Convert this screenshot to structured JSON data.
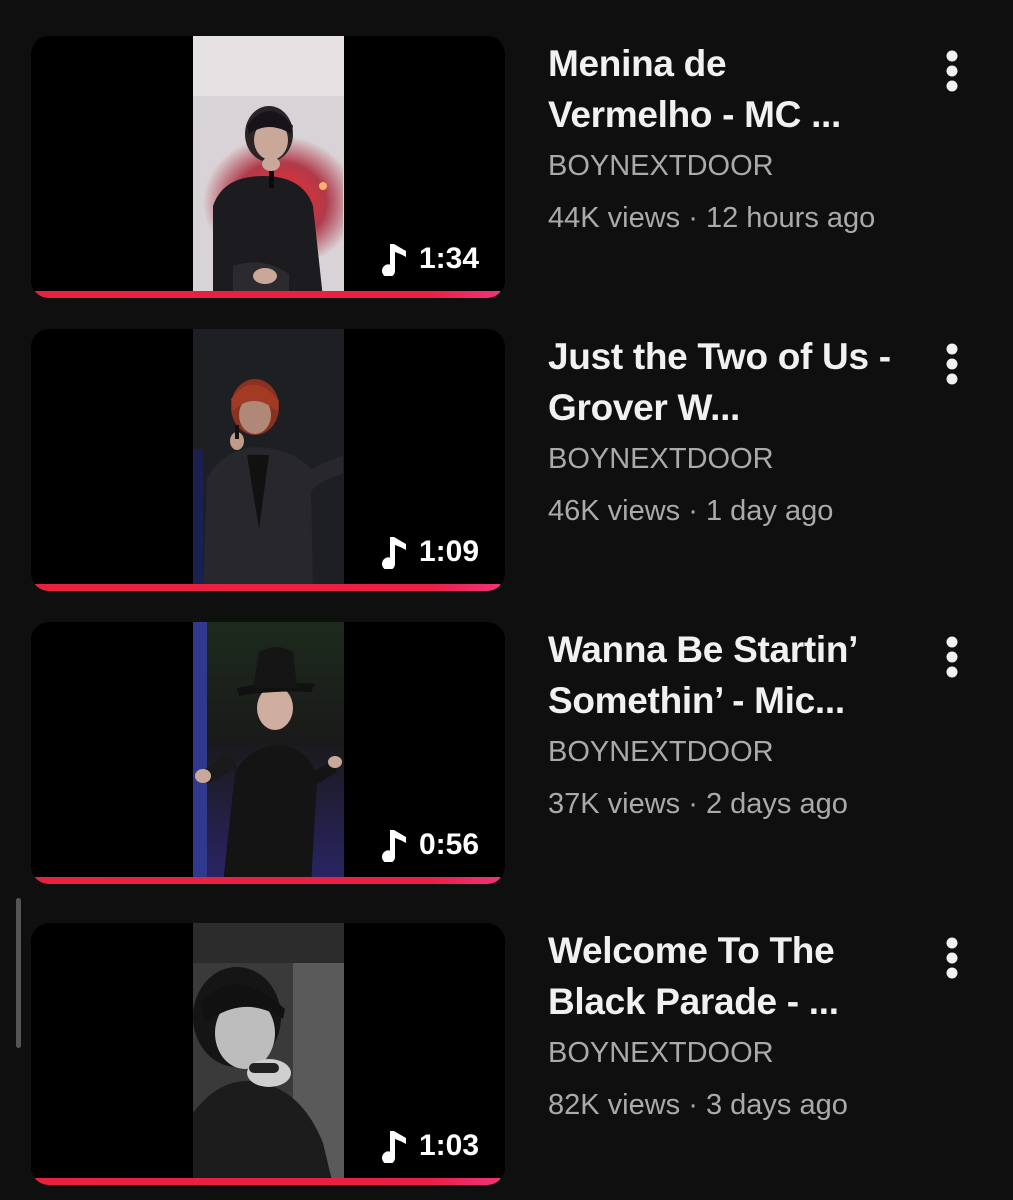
{
  "videos": [
    {
      "title": "Menina de Vermelho - MC ...",
      "channel": "BOYNEXTDOOR",
      "views": "44K views",
      "separator": "·",
      "age": "12 hours ago",
      "duration": "1:34",
      "watched_fraction": 0.99,
      "thumbnail_scene": "singer-red-hood"
    },
    {
      "title": "Just the Two of Us - Grover W...",
      "channel": "BOYNEXTDOOR",
      "views": "46K views",
      "separator": "·",
      "age": "1 day ago",
      "duration": "1:09",
      "watched_fraction": 0.99,
      "thumbnail_scene": "singer-dark-suit"
    },
    {
      "title": "Wanna Be Startin’ Somethin’ - Mic...",
      "channel": "BOYNEXTDOOR",
      "views": "37K views",
      "separator": "·",
      "age": "2 days ago",
      "duration": "0:56",
      "watched_fraction": 0.99,
      "thumbnail_scene": "dancer-fedora"
    },
    {
      "title": "Welcome To The Black Parade - ...",
      "channel": "BOYNEXTDOOR",
      "views": "82K views",
      "separator": "·",
      "age": "3 days ago",
      "duration": "1:03",
      "watched_fraction": 0.99,
      "thumbnail_scene": "singer-monochrome"
    }
  ],
  "icons": {
    "duration": "music-note-icon",
    "menu": "more-vert-icon"
  },
  "colors": {
    "background": "#0f0f0f",
    "progress": "#e8223e",
    "title": "#f1f1f1",
    "secondary": "#aaaaaa"
  }
}
